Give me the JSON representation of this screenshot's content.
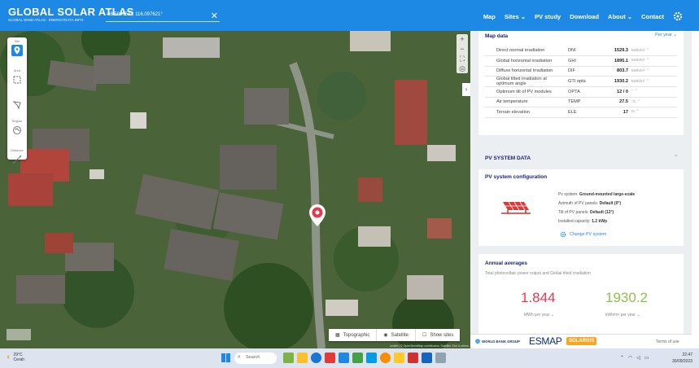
{
  "header": {
    "logo_title": "GLOBAL SOLAR ATLAS",
    "logo_sub": "GLOBAL WIND ATLAS · ENERGYDATA.INFO",
    "coords": "-08.588053°, 116.097621°",
    "nav": [
      "Map",
      "Sites ⌄",
      "PV study",
      "Download",
      "About ⌄",
      "Contact"
    ]
  },
  "map": {
    "tools": [
      {
        "label": "Site",
        "icon": "pin-icon"
      },
      {
        "label": "Area",
        "icon": "area-icon"
      },
      {
        "label": "",
        "icon": "polygon-icon"
      },
      {
        "label": "Region",
        "icon": "region-icon"
      },
      {
        "label": "Distance",
        "icon": "ruler-icon"
      }
    ],
    "zoom_in": "+",
    "zoom_out": "−",
    "layers": [
      "Topographic",
      "Satellite",
      "Show sites"
    ],
    "attribution": "Leaflet | © OpenStreetMap contributors, Satellite: Esri & others",
    "colors": {
      "pin": "#e53950",
      "accent": "#1e88e5"
    }
  },
  "map_data": {
    "title": "Map data",
    "period": "Per year ⌄",
    "rows": [
      {
        "label": "Direct normal irradiation",
        "abbr": "DNI",
        "value": "1529.3",
        "unit": "kWh/m² ⌃"
      },
      {
        "label": "Global horizontal irradiation",
        "abbr": "GHI",
        "value": "1895.1",
        "unit": "kWh/m² ⌃"
      },
      {
        "label": "Diffuse horizontal irradiation",
        "abbr": "DIF",
        "value": "803.7",
        "unit": "kWh/m² ⌃"
      },
      {
        "label": "Global tilted irradiation at optimum angle",
        "abbr": "GTI opta",
        "value": "1930.2",
        "unit": "kWh/m² ⌃"
      },
      {
        "label": "Optimum tilt of PV modules",
        "abbr": "OPTA",
        "value": "12 / 0",
        "unit": "° ⌃"
      },
      {
        "label": "Air temperature",
        "abbr": "TEMP",
        "value": "27.5",
        "unit": "°C ⌃"
      },
      {
        "label": "Terrain elevation",
        "abbr": "ELE",
        "value": "17",
        "unit": "m ⌃"
      }
    ]
  },
  "pv": {
    "section_title": "PV SYSTEM DATA",
    "config_title": "PV system configuration",
    "system_prefix": "Pv system: ",
    "system": "Ground-mounted large-scale",
    "azimuth_prefix": "Azimuth of PV panels: ",
    "azimuth": "Default (0°)",
    "tilt_prefix": "Tilt of PV panels: ",
    "tilt": "Default (12°)",
    "capacity_prefix": "Installed capacity: ",
    "capacity": "1.2 kWp",
    "change": "Change PV system"
  },
  "annual": {
    "title": "Annual averages",
    "subtitle": "Total photovoltaic power output and Global tilted irradiation",
    "pvout": "1.844",
    "pvout_unit": "MWh per year ⌄",
    "gti": "1930.2",
    "gti_unit": "kWh/m² per year ⌄"
  },
  "footer": {
    "wbg": "WORLD BANK GROUP",
    "esmap": "ESMAP",
    "solargis": "SOLARGIS",
    "terms": "Terms of use"
  },
  "taskbar": {
    "weather_temp": "29°C",
    "weather_desc": "Cerah",
    "search": "Search",
    "time": "22:47",
    "date": "30/09/2023"
  }
}
